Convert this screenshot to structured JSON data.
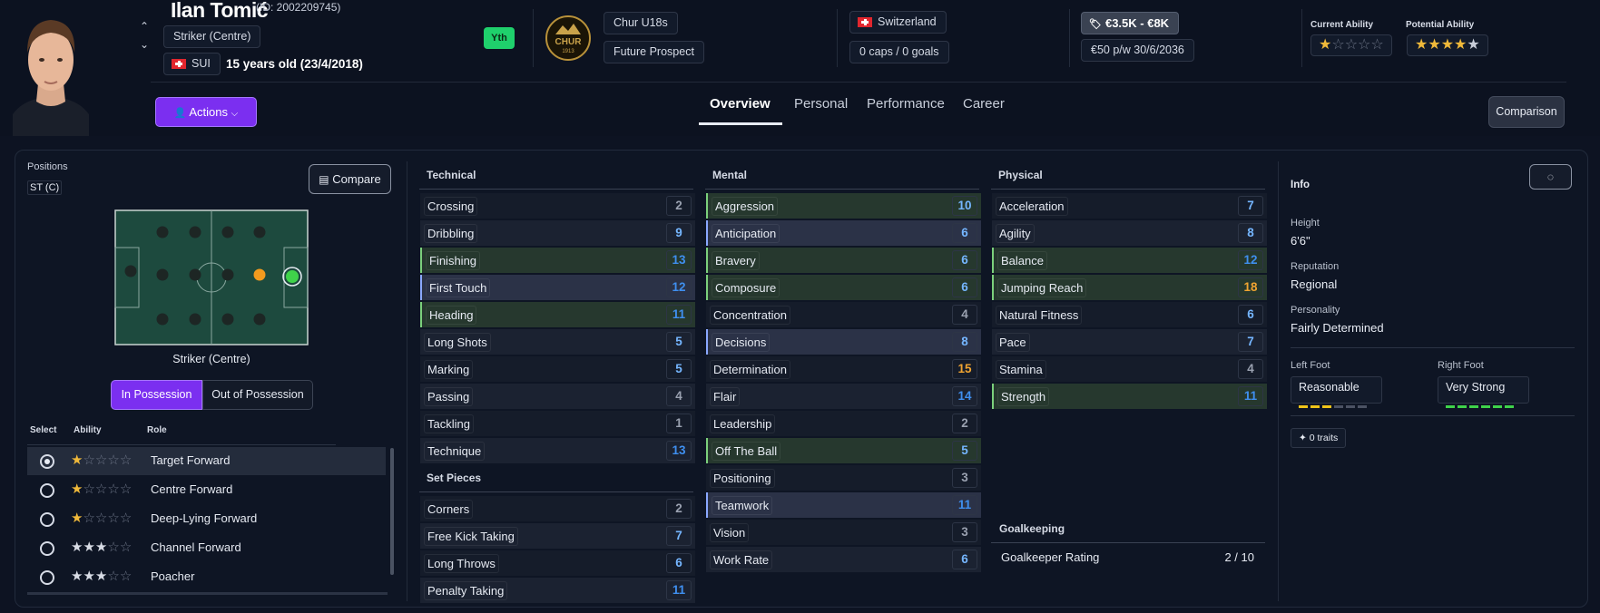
{
  "player": {
    "name": "Ilan Tomić",
    "id_text": "(ID: 2002209745)",
    "position": "Striker (Centre)",
    "nationality_code": "SUI",
    "age_text": "15 years old (23/4/2018)",
    "youth_badge": "Yth"
  },
  "club": {
    "logo_text": "CHUR",
    "logo_year": "1913",
    "team": "Chur U18s",
    "status": "Future Prospect"
  },
  "nation": {
    "country": "Switzerland",
    "caps": "0 caps / 0 goals"
  },
  "contract": {
    "value": "€3.5K - €8K",
    "wage": "€50 p/w",
    "expiry": "30/6/2036"
  },
  "ability": {
    "current_label": "Current Ability",
    "current_stars": 1,
    "potential_label": "Potential Ability",
    "potential_stars": 4
  },
  "actions_label": "Actions",
  "tabs": [
    "Overview",
    "Personal",
    "Performance",
    "Career"
  ],
  "comparison_label": "Comparison",
  "positions": {
    "label": "Positions",
    "value": "ST (C)",
    "compare_label": "Compare",
    "role_caption": "Striker (Centre)",
    "in_possession": "In Possession",
    "out_possession": "Out of Possession"
  },
  "roles_table": {
    "headers": [
      "Select",
      "Ability",
      "Role"
    ],
    "rows": [
      {
        "name": "Target Forward",
        "stars": 1,
        "selected": true
      },
      {
        "name": "Centre Forward",
        "stars": 1,
        "selected": false
      },
      {
        "name": "Deep-Lying Forward",
        "stars": 1,
        "selected": false
      },
      {
        "name": "Channel Forward",
        "stars": 3,
        "selected": false
      },
      {
        "name": "Poacher",
        "stars": 3,
        "selected": false
      }
    ]
  },
  "technical": {
    "title": "Technical",
    "attrs": [
      {
        "name": "Crossing",
        "value": "2"
      },
      {
        "name": "Dribbling",
        "value": "9"
      },
      {
        "name": "Finishing",
        "value": "13"
      },
      {
        "name": "First Touch",
        "value": "12"
      },
      {
        "name": "Heading",
        "value": "11"
      },
      {
        "name": "Long Shots",
        "value": "5"
      },
      {
        "name": "Marking",
        "value": "5"
      },
      {
        "name": "Passing",
        "value": "4"
      },
      {
        "name": "Tackling",
        "value": "1"
      },
      {
        "name": "Technique",
        "value": "13"
      }
    ]
  },
  "set_pieces": {
    "title": "Set Pieces",
    "attrs": [
      {
        "name": "Corners",
        "value": "2"
      },
      {
        "name": "Free Kick Taking",
        "value": "7"
      },
      {
        "name": "Long Throws",
        "value": "6"
      },
      {
        "name": "Penalty Taking",
        "value": "11"
      }
    ]
  },
  "mental": {
    "title": "Mental",
    "attrs": [
      {
        "name": "Aggression",
        "value": "10"
      },
      {
        "name": "Anticipation",
        "value": "6"
      },
      {
        "name": "Bravery",
        "value": "6"
      },
      {
        "name": "Composure",
        "value": "6"
      },
      {
        "name": "Concentration",
        "value": "4"
      },
      {
        "name": "Decisions",
        "value": "8"
      },
      {
        "name": "Determination",
        "value": "15"
      },
      {
        "name": "Flair",
        "value": "14"
      },
      {
        "name": "Leadership",
        "value": "2"
      },
      {
        "name": "Off The Ball",
        "value": "5"
      },
      {
        "name": "Positioning",
        "value": "3"
      },
      {
        "name": "Teamwork",
        "value": "11"
      },
      {
        "name": "Vision",
        "value": "3"
      },
      {
        "name": "Work Rate",
        "value": "6"
      }
    ]
  },
  "physical": {
    "title": "Physical",
    "attrs": [
      {
        "name": "Acceleration",
        "value": "7"
      },
      {
        "name": "Agility",
        "value": "8"
      },
      {
        "name": "Balance",
        "value": "12"
      },
      {
        "name": "Jumping Reach",
        "value": "18"
      },
      {
        "name": "Natural Fitness",
        "value": "6"
      },
      {
        "name": "Pace",
        "value": "7"
      },
      {
        "name": "Stamina",
        "value": "4"
      },
      {
        "name": "Strength",
        "value": "11"
      }
    ]
  },
  "goalkeeping": {
    "title": "Goalkeeping",
    "label": "Goalkeeper Rating",
    "value": "2 / 10"
  },
  "info": {
    "title": "Info",
    "height_label": "Height",
    "height": "6'6\"",
    "reputation_label": "Reputation",
    "reputation": "Regional",
    "personality_label": "Personality",
    "personality": "Fairly Determined",
    "left_foot_label": "Left Foot",
    "left_foot": "Reasonable",
    "left_foot_level": 3,
    "right_foot_label": "Right Foot",
    "right_foot": "Very Strong",
    "right_foot_level": 6,
    "traits": "0 traits"
  },
  "colors": {
    "accent": "#7b2ff0",
    "green_attr": "#26382e",
    "blue_attr": "#2b3247",
    "value_blue": "#3f8fef",
    "value_orange": "#f0a431",
    "star": "#f0b93a"
  }
}
